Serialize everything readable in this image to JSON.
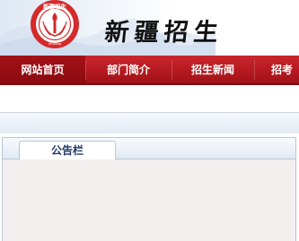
{
  "header": {
    "site_title": "新疆招生",
    "logo_text": "新疆招生",
    "logo_sub": "Xinjiang"
  },
  "nav": {
    "items": [
      {
        "label": "网站首页",
        "active": true
      },
      {
        "label": "部门简介",
        "active": false
      },
      {
        "label": "招生新闻",
        "active": false
      },
      {
        "label": "招考",
        "active": false
      }
    ]
  },
  "notice_panel": {
    "tab_label": "公告栏"
  },
  "colors": {
    "nav_red": "#b51a20",
    "logo_red": "#d42a2a",
    "panel_bg": "#f3efef",
    "tab_text": "#1f3a66"
  }
}
